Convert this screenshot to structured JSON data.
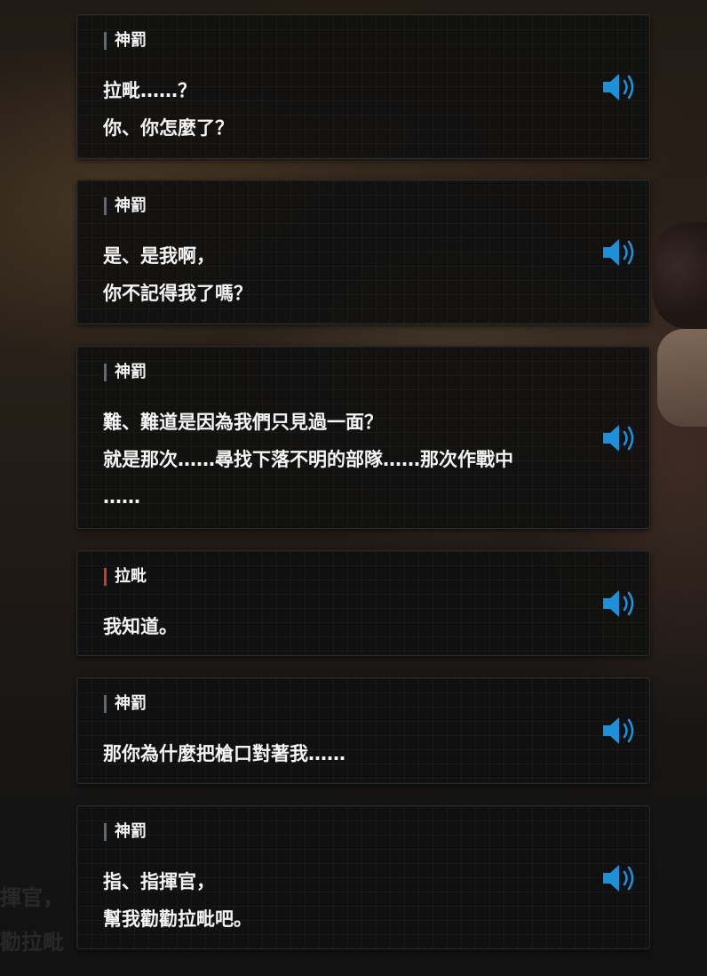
{
  "background_text": [
    "揮官，",
    "勸拉毗"
  ],
  "dialogs": [
    {
      "speaker": "神罰",
      "speaker_color": "#5b6a78",
      "lines": [
        "拉毗……？",
        "你、你怎麼了？"
      ]
    },
    {
      "speaker": "神罰",
      "speaker_color": "#5b6a78",
      "lines": [
        "是、是我啊，",
        "你不記得我了嗎？"
      ]
    },
    {
      "speaker": "神罰",
      "speaker_color": "#5b6a78",
      "lines": [
        "難、難道是因為我們只見過一面？",
        "就是那次……尋找下落不明的部隊……那次作戰中",
        "……"
      ]
    },
    {
      "speaker": "拉毗",
      "speaker_color": "#d23a1e",
      "lines": [
        "我知道。"
      ]
    },
    {
      "speaker": "神罰",
      "speaker_color": "#5b6a78",
      "lines": [
        "那你為什麼把槍口對著我……"
      ]
    },
    {
      "speaker": "神罰",
      "speaker_color": "#5b6a78",
      "lines": [
        "指、指揮官，",
        "幫我勸勸拉毗吧。"
      ]
    }
  ],
  "voice_icon": "speaker-icon",
  "accent_color": "#1e90d8"
}
